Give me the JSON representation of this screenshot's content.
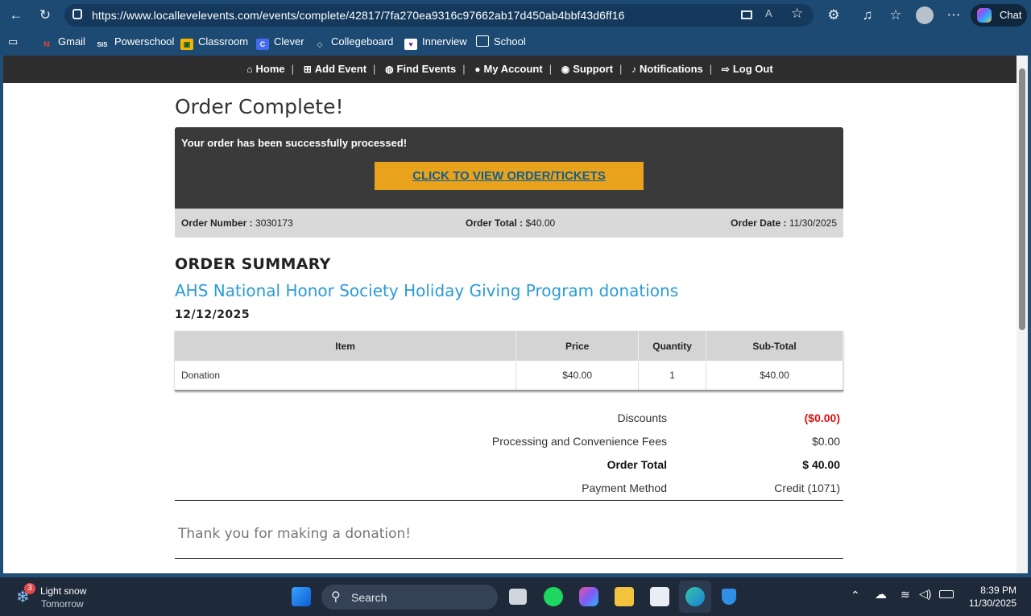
{
  "browser": {
    "url": "https://www.locallevelevents.com/events/complete/42817/7fa270ea9316c97662ab17d450ab4bbf43d6ff16",
    "chat_label": "Chat",
    "bookmarks": [
      "Gmail",
      "Powerschool",
      "Classroom",
      "Clever",
      "Collegeboard",
      "Innerview",
      "School"
    ]
  },
  "site_nav": {
    "items": [
      {
        "label": "Home",
        "icon": "home-icon"
      },
      {
        "label": "Add Event",
        "icon": "plus-square-icon"
      },
      {
        "label": "Find Events",
        "icon": "globe-icon"
      },
      {
        "label": "My Account",
        "icon": "user-icon"
      },
      {
        "label": "Support",
        "icon": "chat-bubble-icon"
      },
      {
        "label": "Notifications",
        "icon": "bell-icon"
      },
      {
        "label": "Log Out",
        "icon": "sign-out-icon"
      }
    ]
  },
  "page": {
    "title": "Order Complete!",
    "confirm_message": "Your order has been successfully processed!",
    "view_button": "CLICK TO VIEW ORDER/TICKETS",
    "order_number_label": "Order Number :",
    "order_number": "3030173",
    "order_total_label": "Order Total :",
    "order_total": "$40.00",
    "order_date_label": "Order Date :",
    "order_date": "11/30/2025",
    "summary_heading": "ORDER SUMMARY",
    "event_title": "AHS National Honor Society Holiday Giving Program donations",
    "event_date": "12/12/2025",
    "table": {
      "headers": [
        "Item",
        "Price",
        "Quantity",
        "Sub-Total"
      ],
      "rows": [
        [
          "Donation",
          "$40.00",
          "1",
          "$40.00"
        ]
      ]
    },
    "totals": [
      {
        "label": "Discounts",
        "value": "($0.00)"
      },
      {
        "label": "Processing and Convenience Fees",
        "value": "$0.00"
      },
      {
        "label": "Order Total",
        "value": "$ 40.00"
      },
      {
        "label": "Payment Method",
        "value": "Credit (1071)"
      }
    ],
    "thank_you": "Thank you for making a donation!"
  },
  "taskbar": {
    "weather_badge": "3",
    "weather_line1": "Light snow",
    "weather_line2": "Tomorrow",
    "search_label": "Search",
    "time": "8:39 PM",
    "date": "11/30/2025"
  },
  "colors": {
    "nav_bg": "#2d2d2d",
    "button_orange": "#e8a21c",
    "link_blue": "#2b9bd6",
    "discount_red": "#e01010"
  }
}
